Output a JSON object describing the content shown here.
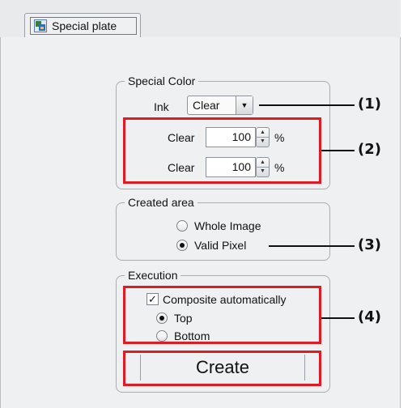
{
  "tab": {
    "label": "Special plate",
    "icon": "special-plate-icon"
  },
  "special_color": {
    "legend": "Special Color",
    "ink_label": "Ink",
    "ink_value": "Clear",
    "rows": [
      {
        "label": "Clear",
        "value": "100",
        "unit": "%"
      },
      {
        "label": "Clear",
        "value": "100",
        "unit": "%"
      }
    ]
  },
  "created_area": {
    "legend": "Created area",
    "options": [
      {
        "label": "Whole Image",
        "selected": false
      },
      {
        "label": "Valid Pixel",
        "selected": true
      }
    ]
  },
  "execution": {
    "legend": "Execution",
    "composite_label": "Composite automatically",
    "composite_checked": true,
    "options": [
      {
        "label": "Top",
        "selected": true
      },
      {
        "label": "Bottom",
        "selected": false
      }
    ],
    "create_label": "Create"
  },
  "callouts": [
    "(1)",
    "(2)",
    "(3)",
    "(4)"
  ],
  "colors": {
    "highlight": "#e01b24"
  }
}
